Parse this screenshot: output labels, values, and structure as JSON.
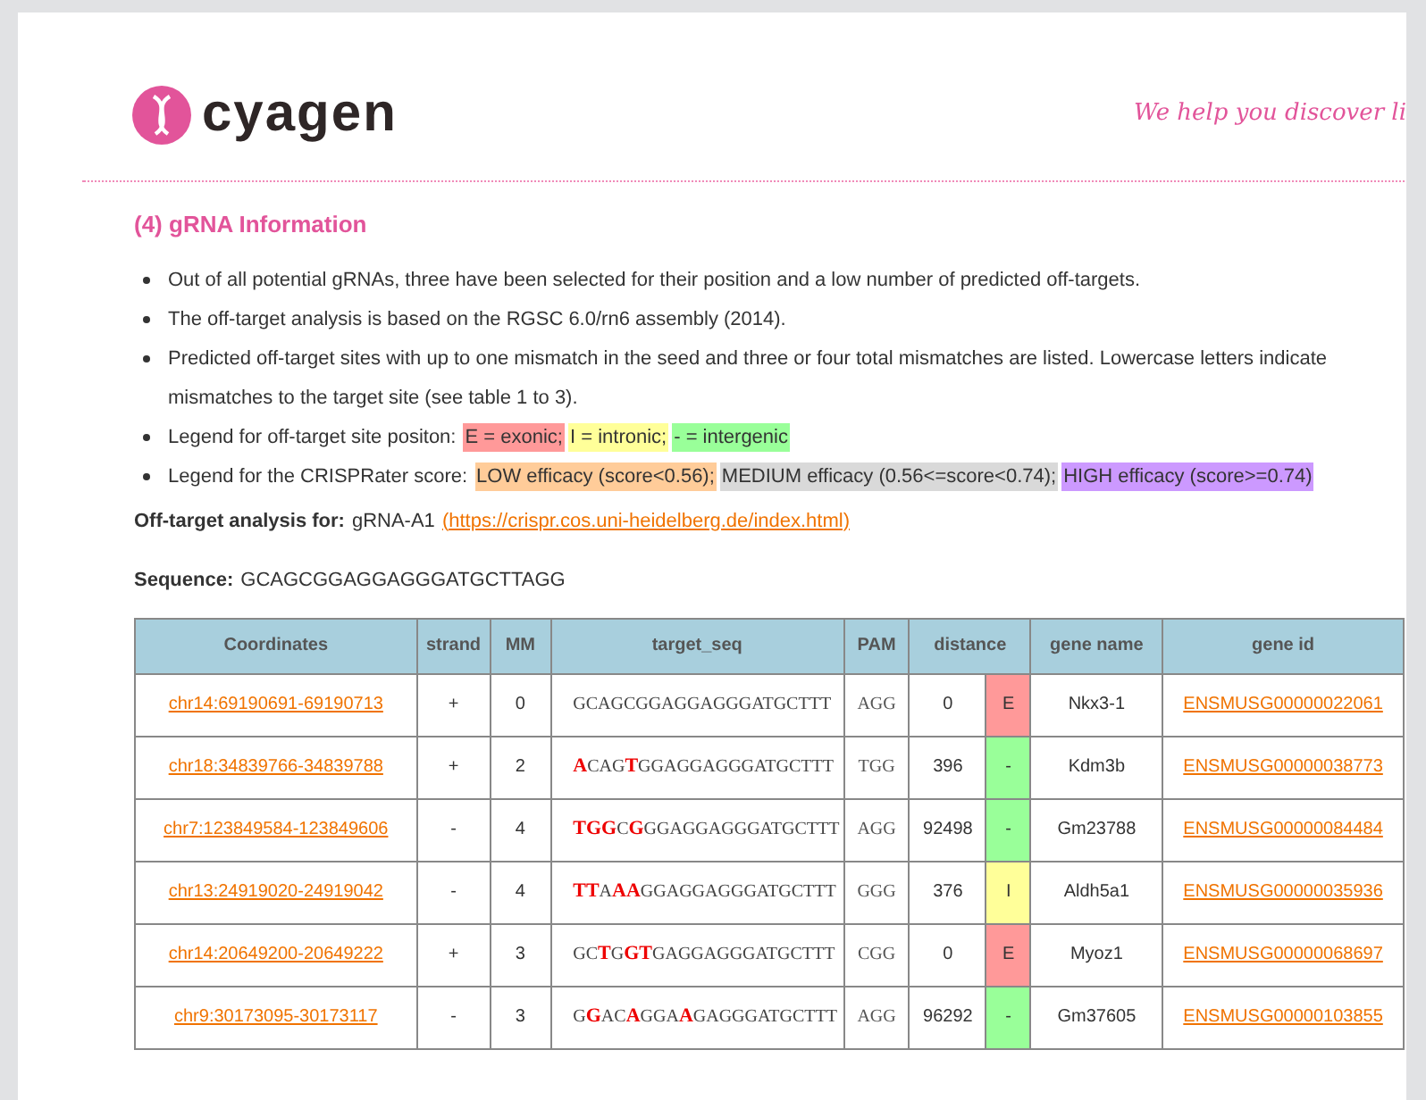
{
  "header": {
    "logo_text": "cyagen",
    "tagline": "We help you discover li"
  },
  "section_title": "(4) gRNA Information",
  "bullets": [
    {
      "kind": "text",
      "text": "Out of all potential gRNAs, three have been selected for their position and a low number of predicted off-targets."
    },
    {
      "kind": "text",
      "text": "The off-target analysis is based on the RGSC 6.0/rn6 assembly (2014)."
    },
    {
      "kind": "text",
      "text": "Predicted off-target sites with up to one mismatch in the seed and three or four total mismatches are listed. Lowercase letters indicate mismatches to the target site (see table 1 to 3)."
    },
    {
      "kind": "legend",
      "text": "Legend for off-target site positon:",
      "items": [
        {
          "label": "E = exonic;",
          "color": "#ff9999"
        },
        {
          "label": "I = intronic;",
          "color": "#ffff99"
        },
        {
          "label": "- = intergenic",
          "color": "#99ff99"
        }
      ]
    },
    {
      "kind": "legend",
      "text": "Legend for the CRISPRater score:",
      "items": [
        {
          "label": "LOW efficacy (score<0.56);",
          "color": "#ffcc99"
        },
        {
          "label": "MEDIUM efficacy (0.56<=score<0.74);",
          "color": "#d9d9d9"
        },
        {
          "label": "HIGH efficacy (score>=0.74)",
          "color": "#cc99ff"
        }
      ]
    }
  ],
  "analysis": {
    "label": "Off-target analysis for:",
    "value": "gRNA-A1",
    "link": "(https://crispr.cos.uni-heidelberg.de/index.html)"
  },
  "sequence": {
    "label": "Sequence:",
    "value": "GCAGCGGAGGAGGGATGCTTAGG"
  },
  "table": {
    "columns": [
      "Coordinates",
      "strand",
      "MM",
      "target_seq",
      "PAM",
      "distance",
      "gene name",
      "gene id"
    ],
    "rows": [
      {
        "coordinates": "chr14:69190691-69190713",
        "strand": "+",
        "mm": "0",
        "target_seq": "GCAGCGGAGGAGGGATGCTTT",
        "pam": "AGG",
        "distance": "0",
        "site": "E",
        "color": "#ff9999",
        "gene_name": "Nkx3-1",
        "gene_id": "ENSMUSG00000022061"
      },
      {
        "coordinates": "chr18:34839766-34839788",
        "strand": "+",
        "mm": "2",
        "target_seq": "**A**CAG**T**GGAGGAGGGATGCTTT",
        "pam": "TGG",
        "distance": "396",
        "site": "-",
        "color": "#99ff99",
        "gene_name": "Kdm3b",
        "gene_id": "ENSMUSG00000038773"
      },
      {
        "coordinates": "chr7:123849584-123849606",
        "strand": "-",
        "mm": "4",
        "target_seq": "**TGG**C**G**GGAGGAGGGATGCTTT",
        "pam": "AGG",
        "distance": "92498",
        "site": "-",
        "color": "#99ff99",
        "gene_name": "Gm23788",
        "gene_id": "ENSMUSG00000084484"
      },
      {
        "coordinates": "chr13:24919020-24919042",
        "strand": "-",
        "mm": "4",
        "target_seq": "**TT**A**AA**GGAGGAGGGATGCTTT",
        "pam": "GGG",
        "distance": "376",
        "site": "I",
        "color": "#ffff99",
        "gene_name": "Aldh5a1",
        "gene_id": "ENSMUSG00000035936"
      },
      {
        "coordinates": "chr14:20649200-20649222",
        "strand": "+",
        "mm": "3",
        "target_seq": "GC**T**G**GT**GAGGAGGGATGCTTT",
        "pam": "CGG",
        "distance": "0",
        "site": "E",
        "color": "#ff9999",
        "gene_name": "Myoz1",
        "gene_id": "ENSMUSG00000068697"
      },
      {
        "coordinates": "chr9:30173095-30173117",
        "strand": "-",
        "mm": "3",
        "target_seq": "G**G**AC**A**GGA**A**GAGGGATGCTTT",
        "pam": "AGG",
        "distance": "96292",
        "site": "-",
        "color": "#99ff99",
        "gene_name": "Gm37605",
        "gene_id": "ENSMUSG00000103855"
      }
    ]
  }
}
